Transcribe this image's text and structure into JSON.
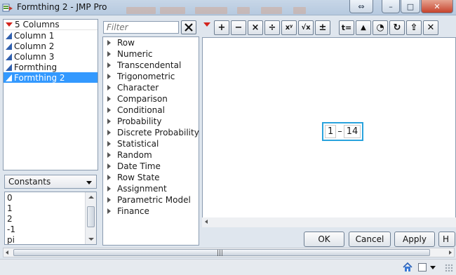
{
  "window": {
    "title": "Formthing 2 - JMP Pro",
    "resize_glyph": "⇔",
    "minimize_glyph": "–",
    "maximize_glyph": "□",
    "close_glyph": "✕"
  },
  "columns": {
    "header": "5 Columns",
    "items": [
      {
        "label": "Column 1",
        "selected": false
      },
      {
        "label": "Column 2",
        "selected": false
      },
      {
        "label": "Column 3",
        "selected": false
      },
      {
        "label": "Formthing",
        "selected": false
      },
      {
        "label": "Formthing 2",
        "selected": true
      }
    ]
  },
  "constants": {
    "selected": "Constants",
    "items": [
      "0",
      "1",
      "2",
      "-1",
      "pi"
    ]
  },
  "functions": {
    "filter_placeholder": "Filter",
    "items": [
      "Row",
      "Numeric",
      "Transcendental",
      "Trigonometric",
      "Character",
      "Comparison",
      "Conditional",
      "Probability",
      "Discrete Probability",
      "Statistical",
      "Random",
      "Date Time",
      "Row State",
      "Assignment",
      "Parametric Model",
      "Finance"
    ]
  },
  "toolbar": {
    "buttons": [
      {
        "name": "add-icon",
        "glyph": "+"
      },
      {
        "name": "subtract-icon",
        "glyph": "−"
      },
      {
        "name": "multiply-icon",
        "glyph": "×"
      },
      {
        "name": "divide-icon",
        "glyph": "÷"
      },
      {
        "name": "power-icon",
        "glyph": "xʸ"
      },
      {
        "name": "root-icon",
        "glyph": "√x"
      },
      {
        "name": "plus-minus-icon",
        "glyph": "±"
      },
      {
        "name": "assign-icon",
        "glyph": "t="
      },
      {
        "name": "raise-icon",
        "glyph": "▲"
      },
      {
        "name": "peel-icon",
        "glyph": "◔"
      },
      {
        "name": "swap-icon",
        "glyph": "↻"
      },
      {
        "name": "unthrow-icon",
        "glyph": "⇪"
      },
      {
        "name": "delete-icon",
        "glyph": "✕"
      }
    ]
  },
  "formula": {
    "left": "1",
    "operator": "–",
    "right": "14"
  },
  "dialog_buttons": {
    "ok": "OK",
    "cancel": "Cancel",
    "apply": "Apply",
    "help": "H"
  },
  "bottom_scroll_grip": "|||",
  "colors": {
    "selection": "#3399ff",
    "formula_border": "#2aa3dd",
    "red_triangle": "#d3241d"
  }
}
